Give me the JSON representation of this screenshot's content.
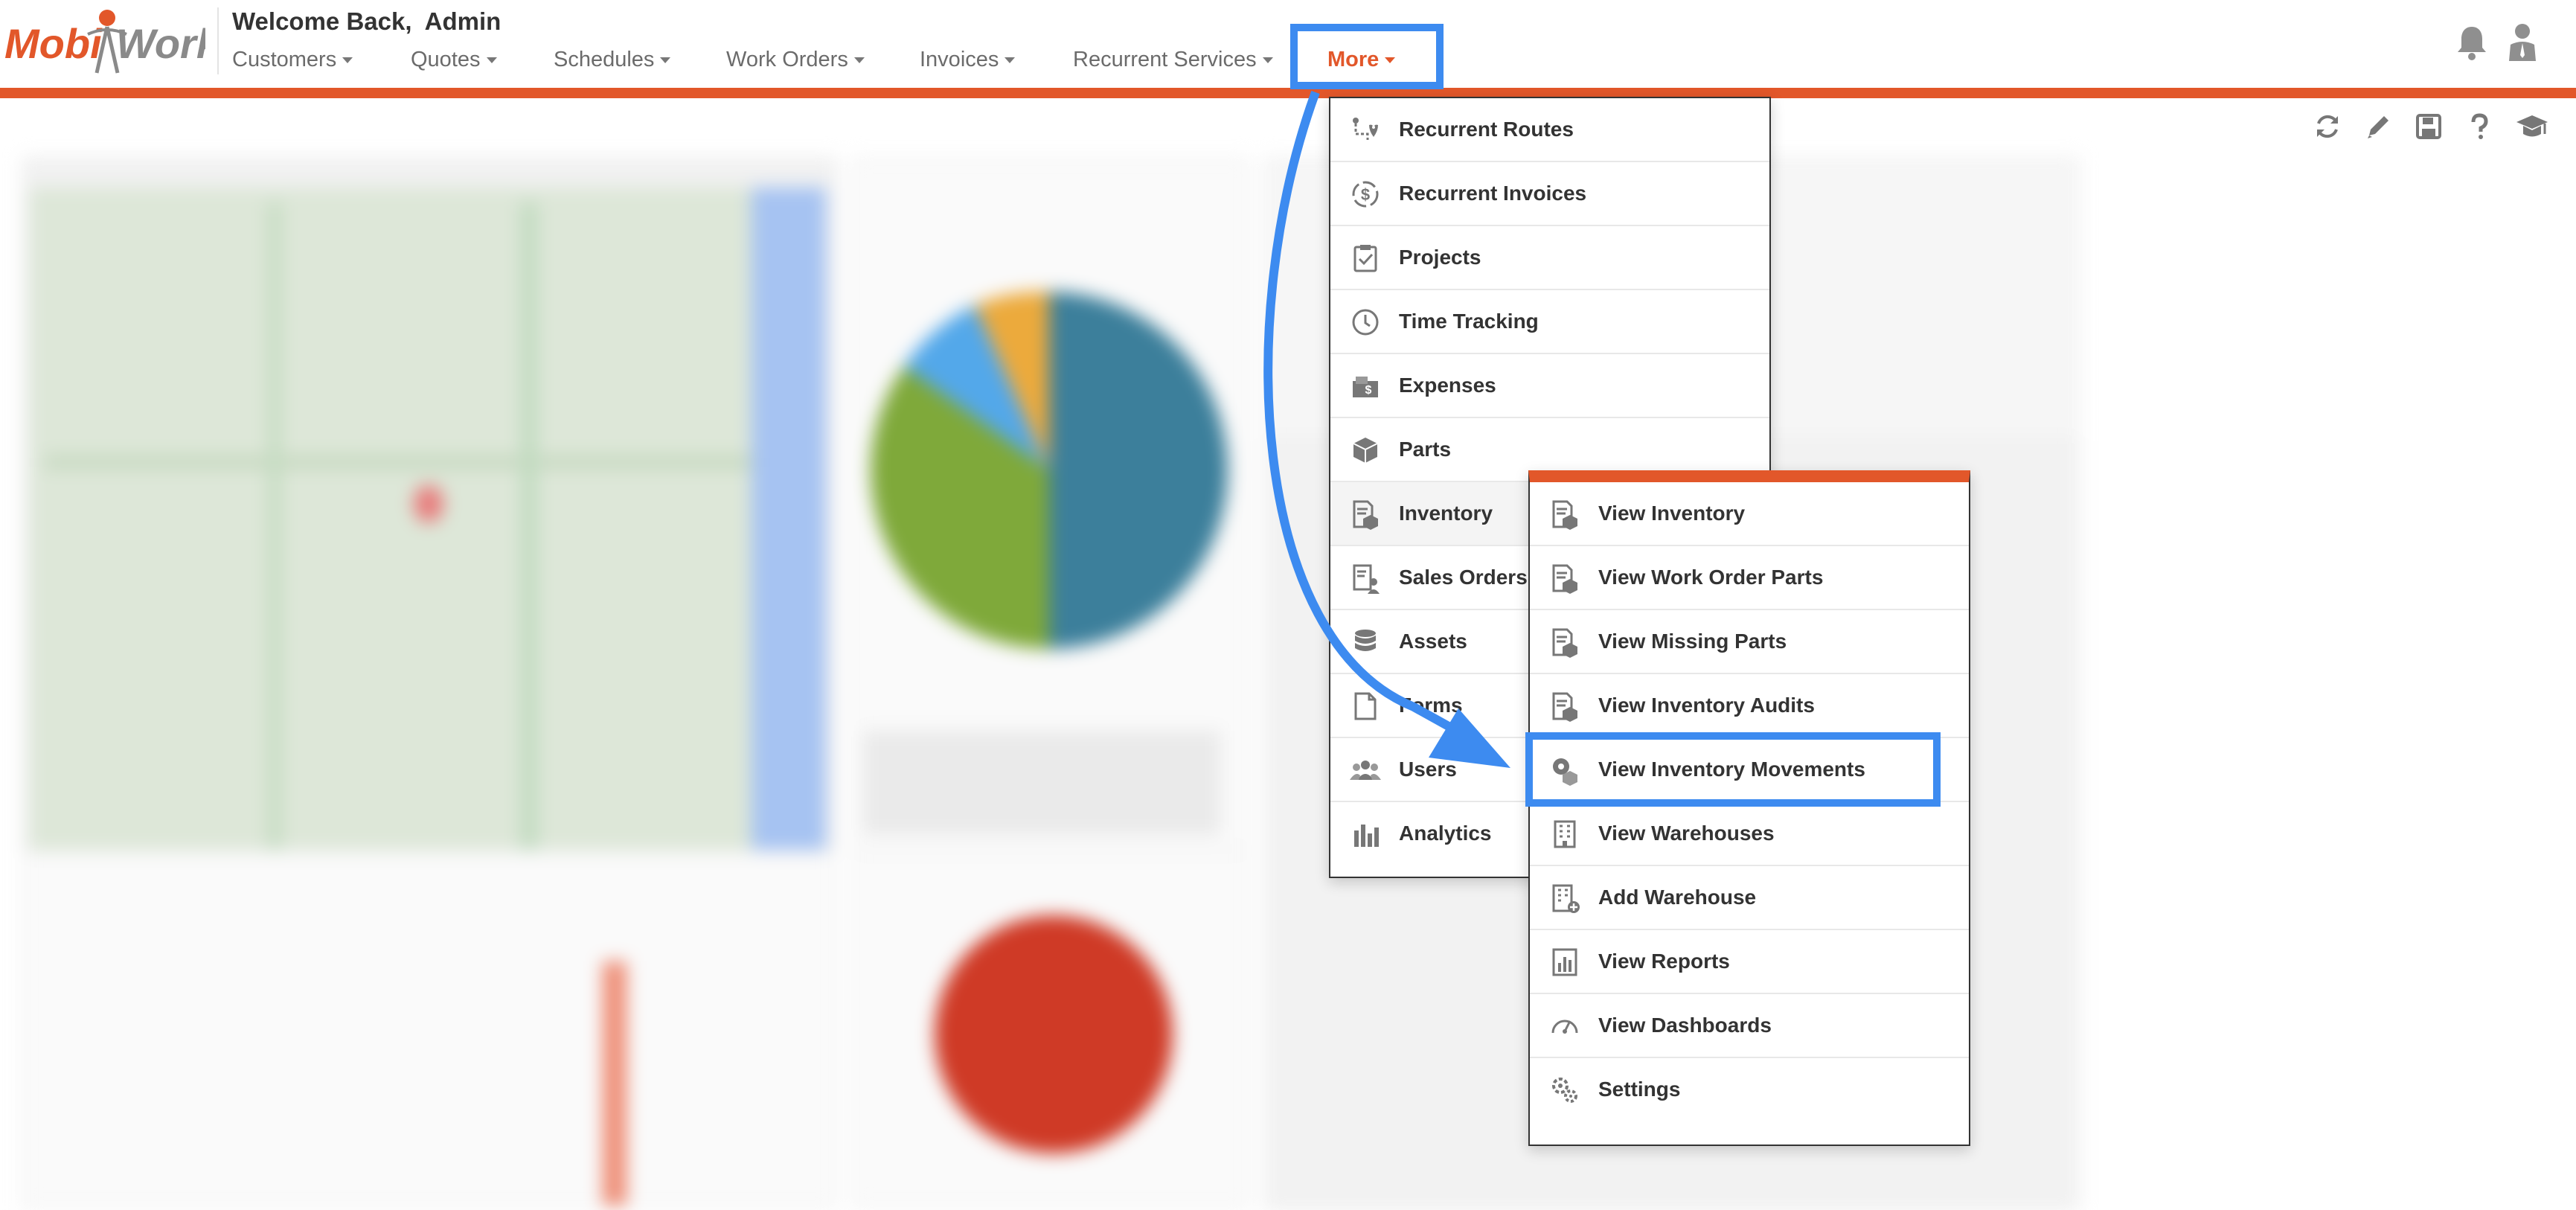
{
  "header": {
    "logo": {
      "part1": "Mobi",
      "part2": "Work"
    },
    "welcome": "Welcome Back,  Admin",
    "nav": [
      {
        "label": "Customers",
        "key": "customers"
      },
      {
        "label": "Quotes",
        "key": "quotes"
      },
      {
        "label": "Schedules",
        "key": "schedules"
      },
      {
        "label": "Work Orders",
        "key": "work-orders"
      },
      {
        "label": "Invoices",
        "key": "invoices"
      },
      {
        "label": "Recurrent Services",
        "key": "recurrent-services"
      },
      {
        "label": "More",
        "key": "more"
      }
    ],
    "icons": [
      "bell-icon",
      "user-icon"
    ]
  },
  "toolbar": {
    "icons": [
      "refresh-icon",
      "pencil-icon",
      "save-icon",
      "help-icon",
      "graduation-cap-icon"
    ]
  },
  "more_menu": {
    "items": [
      {
        "label": "Recurrent Routes",
        "icon": "route-icon"
      },
      {
        "label": "Recurrent Invoices",
        "icon": "dollar-cycle-icon"
      },
      {
        "label": "Projects",
        "icon": "clipboard-check-icon"
      },
      {
        "label": "Time Tracking",
        "icon": "clock-icon"
      },
      {
        "label": "Expenses",
        "icon": "cash-icon"
      },
      {
        "label": "Parts",
        "icon": "cube-icon"
      },
      {
        "label": "Inventory",
        "icon": "inventory-icon"
      },
      {
        "label": "Sales Orders",
        "icon": "sales-order-icon"
      },
      {
        "label": "Assets",
        "icon": "database-icon"
      },
      {
        "label": "Forms",
        "icon": "form-icon"
      },
      {
        "label": "Users",
        "icon": "users-icon"
      },
      {
        "label": "Analytics",
        "icon": "bar-chart-icon"
      }
    ]
  },
  "inventory_submenu": {
    "items": [
      {
        "label": "View Inventory",
        "icon": "inventory-icon"
      },
      {
        "label": "View Work Order Parts",
        "icon": "inventory-icon"
      },
      {
        "label": "View Missing Parts",
        "icon": "inventory-icon"
      },
      {
        "label": "View Inventory Audits",
        "icon": "inventory-icon"
      },
      {
        "label": "View Inventory Movements",
        "icon": "gear-box-icon"
      },
      {
        "label": "View Warehouses",
        "icon": "building-icon"
      },
      {
        "label": "Add Warehouse",
        "icon": "building-add-icon"
      },
      {
        "label": "View Reports",
        "icon": "report-chart-icon"
      },
      {
        "label": "View Dashboards",
        "icon": "gauge-icon"
      },
      {
        "label": "Settings",
        "icon": "gears-icon"
      }
    ]
  },
  "colors": {
    "accent": "#e2572a",
    "highlight": "#3d8bf0",
    "text": "#333333"
  }
}
